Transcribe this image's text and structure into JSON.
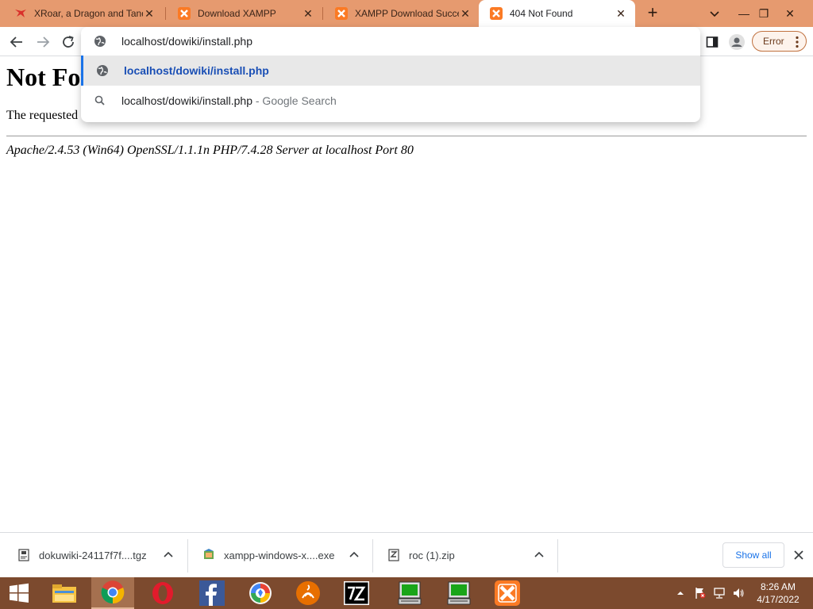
{
  "window": {
    "minimize_glyph": "—",
    "maximize_glyph": "❐",
    "close_glyph": "✕"
  },
  "tabs": [
    {
      "title": "XRoar, a Dragon and Tandy",
      "favicon": "xroar-dragon-icon",
      "active": false
    },
    {
      "title": "Download XAMPP",
      "favicon": "xampp-icon",
      "active": false
    },
    {
      "title": "XAMPP Download Success",
      "favicon": "xampp-icon",
      "active": false
    },
    {
      "title": "404 Not Found",
      "favicon": "xampp-icon",
      "active": true
    }
  ],
  "toolbar": {
    "error_label": "Error"
  },
  "omnibox": {
    "typed_text": "localhost/dowiki/install.php",
    "suggestions": [
      {
        "text": "localhost/dowiki/install.php",
        "suffix": "",
        "icon": "globe-icon",
        "selected": true
      },
      {
        "text": "localhost/dowiki/install.php",
        "suffix": " - Google Search",
        "icon": "search-icon",
        "selected": false
      }
    ]
  },
  "page": {
    "heading": "Not Found",
    "message": "The requested URL was not found on this server.",
    "server_signature": "Apache/2.4.53 (Win64) OpenSSL/1.1.1n PHP/7.4.28 Server at localhost Port 80"
  },
  "downloads": {
    "items": [
      {
        "name": "dokuwiki-24117f7f....tgz",
        "icon": "archive-file-icon"
      },
      {
        "name": "xampp-windows-x....exe",
        "icon": "installer-file-icon"
      },
      {
        "name": "roc (1).zip",
        "icon": "zip-file-icon"
      }
    ],
    "show_all_label": "Show all"
  },
  "taskbar": {
    "apps": [
      "windows-start-icon",
      "file-explorer-icon",
      "chrome-icon",
      "opera-icon",
      "facebook-icon",
      "brave-icon",
      "java-icon",
      "7zip-icon",
      "computer-terminal-icon",
      "computer-terminal-icon",
      "xampp-icon"
    ],
    "time": "8:26 AM",
    "date": "4/17/2022"
  },
  "colors": {
    "tabstrip": "#e69a6f",
    "taskbar": "#7c4a2e",
    "link_blue": "#1a73e8"
  }
}
